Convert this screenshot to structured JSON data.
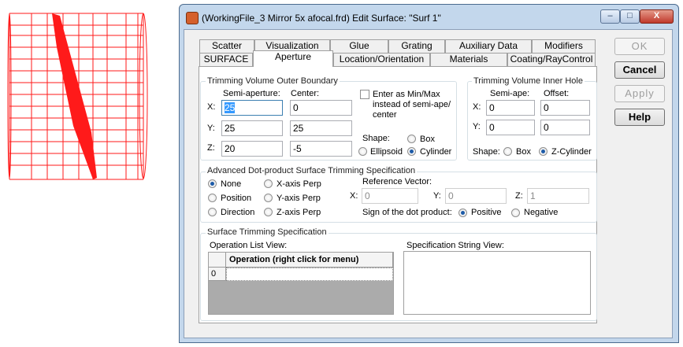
{
  "window": {
    "title": "(WorkingFile_3 Mirror 5x afocal.frd) Edit Surface: \"Surf 1\"",
    "minimize_glyph": "–",
    "maximize_glyph": "□",
    "close_glyph": "X"
  },
  "tabs_row1": [
    "Scatter",
    "Visualization",
    "Glue",
    "Grating",
    "Auxiliary Data",
    "Modifiers"
  ],
  "tabs_row2": [
    "SURFACE",
    "Aperture",
    "Location/Orientation",
    "Materials",
    "Coating/RayControl"
  ],
  "active_tab": "Aperture",
  "outer_boundary": {
    "legend": "Trimming Volume Outer Boundary",
    "semi_aperture_header": "Semi-aperture:",
    "center_header": "Center:",
    "rows": [
      {
        "axis": "X:",
        "semi": "25",
        "center": "0"
      },
      {
        "axis": "Y:",
        "semi": "25",
        "center": "25"
      },
      {
        "axis": "Z:",
        "semi": "20",
        "center": "-5"
      }
    ],
    "minmax_checkbox_label": "Enter as Min/Max instead of semi-ape/ center",
    "shape_label": "Shape:",
    "shape_options": [
      "Box",
      "Ellipsoid",
      "Cylinder"
    ],
    "shape_selected": "Cylinder"
  },
  "inner_hole": {
    "legend": "Trimming Volume Inner Hole",
    "semi_ape_header": "Semi-ape:",
    "offset_header": "Offset:",
    "rows": [
      {
        "axis": "X:",
        "semi": "0",
        "offset": "0"
      },
      {
        "axis": "Y:",
        "semi": "0",
        "offset": "0"
      }
    ],
    "shape_label": "Shape:",
    "shape_options": [
      "Box",
      "Z-Cylinder"
    ],
    "shape_selected": "Z-Cylinder"
  },
  "dot_product": {
    "legend": "Advanced Dot-product Surface Trimming Specification",
    "options": [
      "None",
      "X-axis Perp",
      "Position",
      "Y-axis Perp",
      "Direction",
      "Z-axis Perp"
    ],
    "selected": "None",
    "reference_vector_label": "Reference Vector:",
    "x_label": "X:",
    "x_value": "0",
    "y_label": "Y:",
    "y_value": "0",
    "z_label": "Z:",
    "z_value": "1",
    "sign_label": "Sign of the dot product:",
    "sign_options": [
      "Positive",
      "Negative"
    ],
    "sign_selected": "Positive"
  },
  "surface_trimming": {
    "legend": "Surface Trimming Specification",
    "operation_list_label": "Operation List View:",
    "operation_header": "Operation (right click for menu)",
    "rows": [
      {
        "index": "0",
        "operation": ""
      }
    ],
    "spec_string_label": "Specification String View:"
  },
  "buttons": {
    "ok": "OK",
    "cancel": "Cancel",
    "apply": "Apply",
    "help": "Help"
  },
  "colors": {
    "view_wireframe": "#ff0000",
    "window_frame": "#c3d7ec",
    "radio_dot": "#1d5ba8",
    "selection": "#3399ff"
  }
}
